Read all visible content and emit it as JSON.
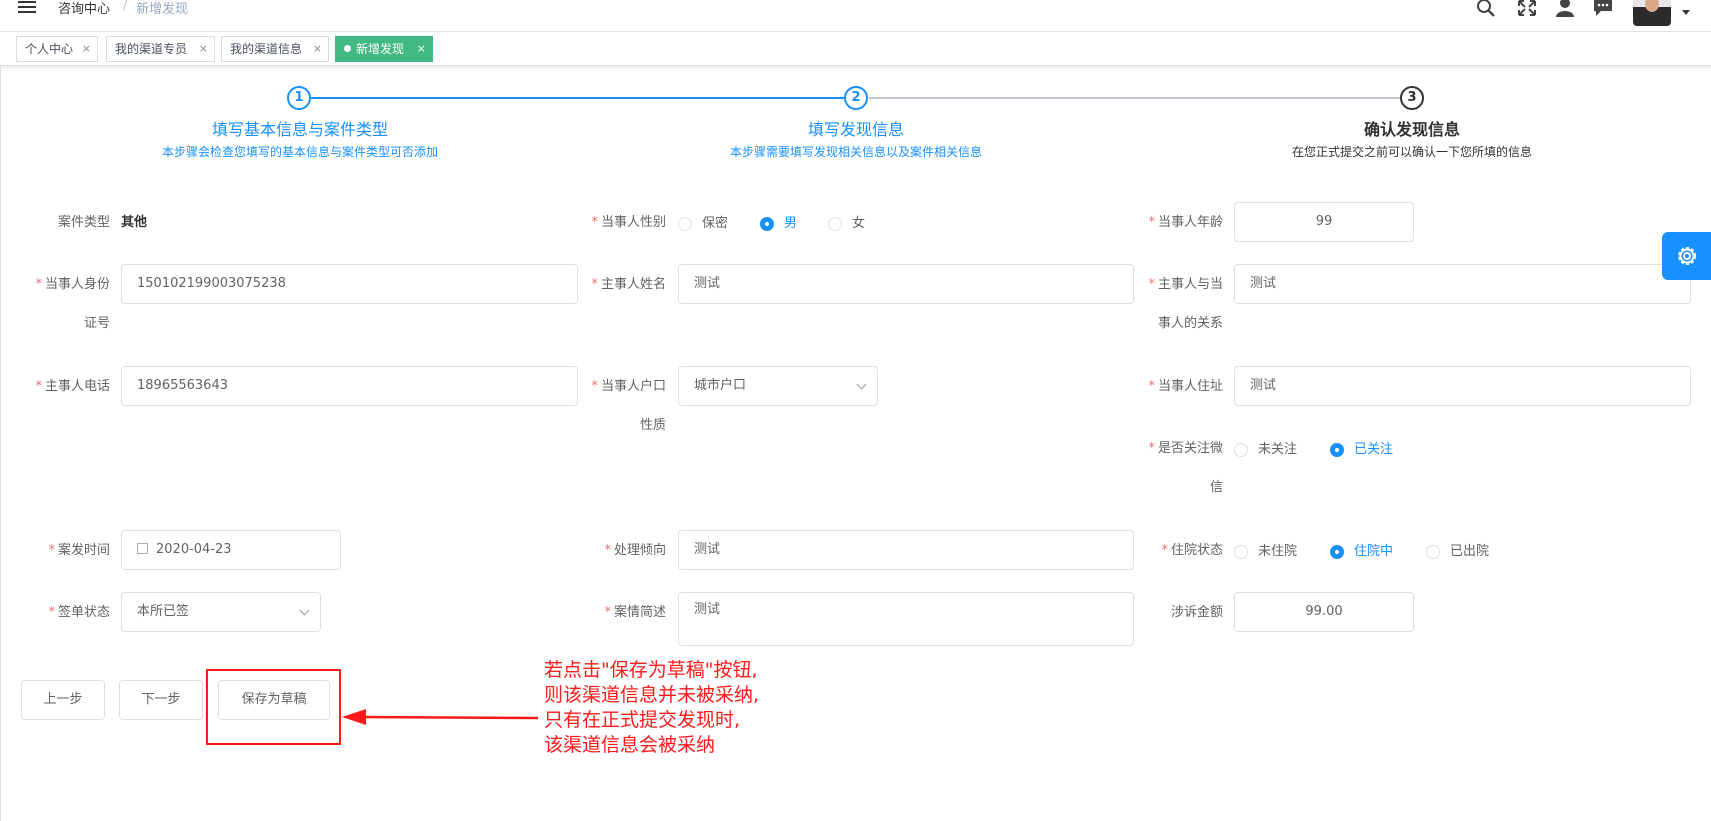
{
  "header": {
    "breadcrumb_parent": "咨询中心",
    "breadcrumb_sep": "/",
    "breadcrumb_current": "新增发现"
  },
  "tags": [
    {
      "label": "个人中心",
      "close": "×"
    },
    {
      "label": "我的渠道专员",
      "close": "×"
    },
    {
      "label": "我的渠道信息",
      "close": "×"
    },
    {
      "label": "新增发现",
      "close": "×"
    }
  ],
  "steps": [
    {
      "num": "1",
      "title": "填写基本信息与案件类型",
      "desc": "本步骤会检查您填写的基本信息与案件类型可否添加"
    },
    {
      "num": "2",
      "title": "填写发现信息",
      "desc": "本步骤需要填写发现相关信息以及案件相关信息"
    },
    {
      "num": "3",
      "title": "确认发现信息",
      "desc": "在您正式提交之前可以确认一下您所填的信息"
    }
  ],
  "form": {
    "case_type": {
      "label": "案件类型",
      "value": "其他"
    },
    "gender": {
      "label": "当事人性别",
      "options": [
        "保密",
        "男",
        "女"
      ],
      "selected": "男"
    },
    "age": {
      "label": "当事人年龄",
      "value": "99"
    },
    "id_no": {
      "label_line1": "当事人身份",
      "label_line2": "证号",
      "value": "150102199003075238"
    },
    "main_name": {
      "label": "主事人姓名",
      "value": "测试"
    },
    "relation": {
      "label_line1": "主事人与当",
      "label_line2": "事人的关系",
      "value": "测试"
    },
    "phone": {
      "label": "主事人电话",
      "value": "18965563643"
    },
    "household": {
      "label_line1": "当事人户口",
      "label_line2": "性质",
      "value": "城市户口"
    },
    "address": {
      "label": "当事人住址",
      "value": "测试"
    },
    "wechat": {
      "label_line1": "是否关注微",
      "label_line2": "信",
      "options": [
        "未关注",
        "已关注"
      ],
      "selected": "已关注"
    },
    "case_time": {
      "label": "案发时间",
      "value": "2020-04-23"
    },
    "tendency": {
      "label": "处理倾向",
      "value": "测试"
    },
    "hospital": {
      "label": "住院状态",
      "options": [
        "未住院",
        "住院中",
        "已出院"
      ],
      "selected": "住院中"
    },
    "sign": {
      "label": "签单状态",
      "value": "本所已签"
    },
    "summary": {
      "label": "案情简述",
      "value": "测试"
    },
    "amount": {
      "label": "涉诉金额",
      "value": "99.00"
    }
  },
  "buttons": {
    "prev": "上一步",
    "next": "下一步",
    "draft": "保存为草稿"
  },
  "annotation": {
    "lines": [
      "若点击\"保存为草稿\"按钮,",
      "则该渠道信息并未被采纳,",
      "只有在正式提交发现时,",
      "该渠道信息会被采纳"
    ]
  },
  "colors": {
    "primary": "#1890ff",
    "tag_active": "#42b983",
    "required": "#f56c6c",
    "annotation": "#ff1a1a"
  },
  "icons": [
    "hamburger-icon",
    "search-icon",
    "fullscreen-icon",
    "user-icon",
    "message-icon",
    "gear-icon",
    "calendar-icon",
    "chevron-down-icon"
  ]
}
